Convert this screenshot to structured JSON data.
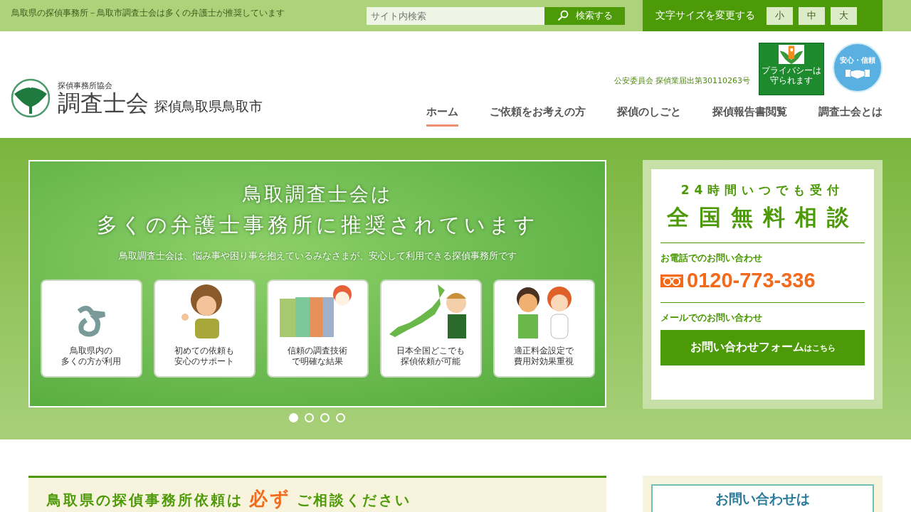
{
  "top_bar": {
    "tagline": "鳥取県の探偵事務所－鳥取市調査士会は多くの弁護士が推奨しています",
    "search": {
      "placeholder": "サイト内検索",
      "button": "検索する"
    },
    "font_size": {
      "label": "文字サイズを変更する",
      "buttons": [
        "小",
        "中",
        "大"
      ]
    }
  },
  "header": {
    "logo": {
      "small": "探偵事務所協会",
      "name": "調査士会",
      "region": "探偵鳥取県鳥取市"
    },
    "license": "公安委員会 探偵業届出第30110263号",
    "privacy_badge": "プライバシーは守られます",
    "safety_badge": "安心・信頼",
    "nav": [
      {
        "label": "ホーム",
        "selected": true
      },
      {
        "label": "ご依頼をお考えの方",
        "selected": false
      },
      {
        "label": "探偵のしごと",
        "selected": false
      },
      {
        "label": "探偵報告書閲覧",
        "selected": false
      },
      {
        "label": "調査士会とは",
        "selected": false
      }
    ]
  },
  "banner": {
    "title_1": "鳥取調査士会は",
    "title_2": "多くの弁護士事務所に推奨されています",
    "subtitle": "鳥取調査士会は、悩み事や困り事を抱えているみなさまが、安心して利用できる探偵事務所です",
    "cards": [
      {
        "kind": "emblem",
        "line_1": "鳥取県内の",
        "line_2": "多くの方が利用"
      },
      {
        "kind": "person",
        "line_1": "初めての依頼も",
        "line_2": "安心のサポート"
      },
      {
        "kind": "files",
        "line_1": "信頼の調査技術",
        "line_2": "で明確な結果"
      },
      {
        "kind": "map",
        "line_1": "日本全国どこでも",
        "line_2": "探偵依頼が可能"
      },
      {
        "kind": "couple",
        "line_1": "適正料金設定で",
        "line_2": "費用対効果重視"
      }
    ],
    "dots": [
      {
        "selected": true
      },
      {
        "selected": false
      },
      {
        "selected": false
      },
      {
        "selected": false
      }
    ]
  },
  "consult": {
    "line_1": "24時間いつでも受付",
    "line_2": "全国無料相談",
    "phone_label": "お電話でのお問い合わせ",
    "phone": "0120-773-336",
    "mail_label": "メールでのお問い合わせ",
    "form_button": "お問い合わせフォーム",
    "form_suffix": "はこちら"
  },
  "section": {
    "heading_1": "鳥取県の探偵事務所依頼は",
    "heading_em": "必ず",
    "heading_2": "ご相談ください",
    "side": "お問い合わせは"
  }
}
